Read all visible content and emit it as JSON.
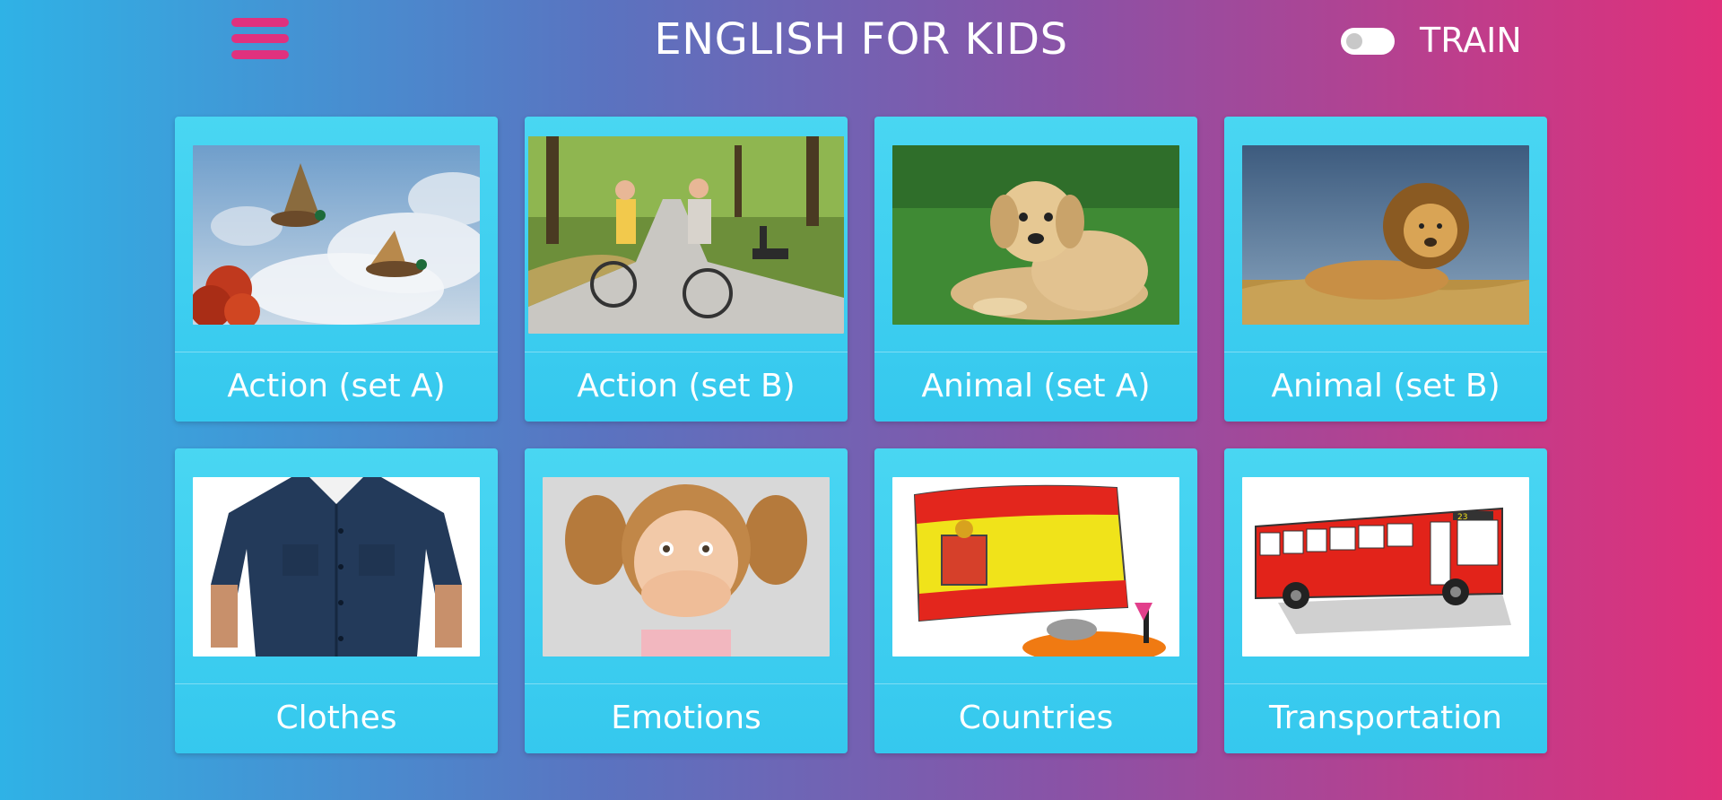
{
  "header": {
    "title": "ENGLISH FOR KIDS",
    "menu_icon": "hamburger-menu-icon",
    "toggle": {
      "label": "TRAIN",
      "state": "off"
    }
  },
  "colors": {
    "menu_accent": "#e0317e",
    "card": "#3fd0f0",
    "gradient_start": "#2fb2e6",
    "gradient_end": "#e0307a"
  },
  "categories": [
    {
      "label": "Action (set A)",
      "image": "flying-ducks"
    },
    {
      "label": "Action (set B)",
      "image": "kids-cycling"
    },
    {
      "label": "Animal (set A)",
      "image": "puppy-on-grass"
    },
    {
      "label": "Animal (set B)",
      "image": "lion"
    },
    {
      "label": "Clothes",
      "image": "shirt"
    },
    {
      "label": "Emotions",
      "image": "surprised-girl"
    },
    {
      "label": "Countries",
      "image": "spain-flag"
    },
    {
      "label": "Transportation",
      "image": "red-bus"
    }
  ]
}
